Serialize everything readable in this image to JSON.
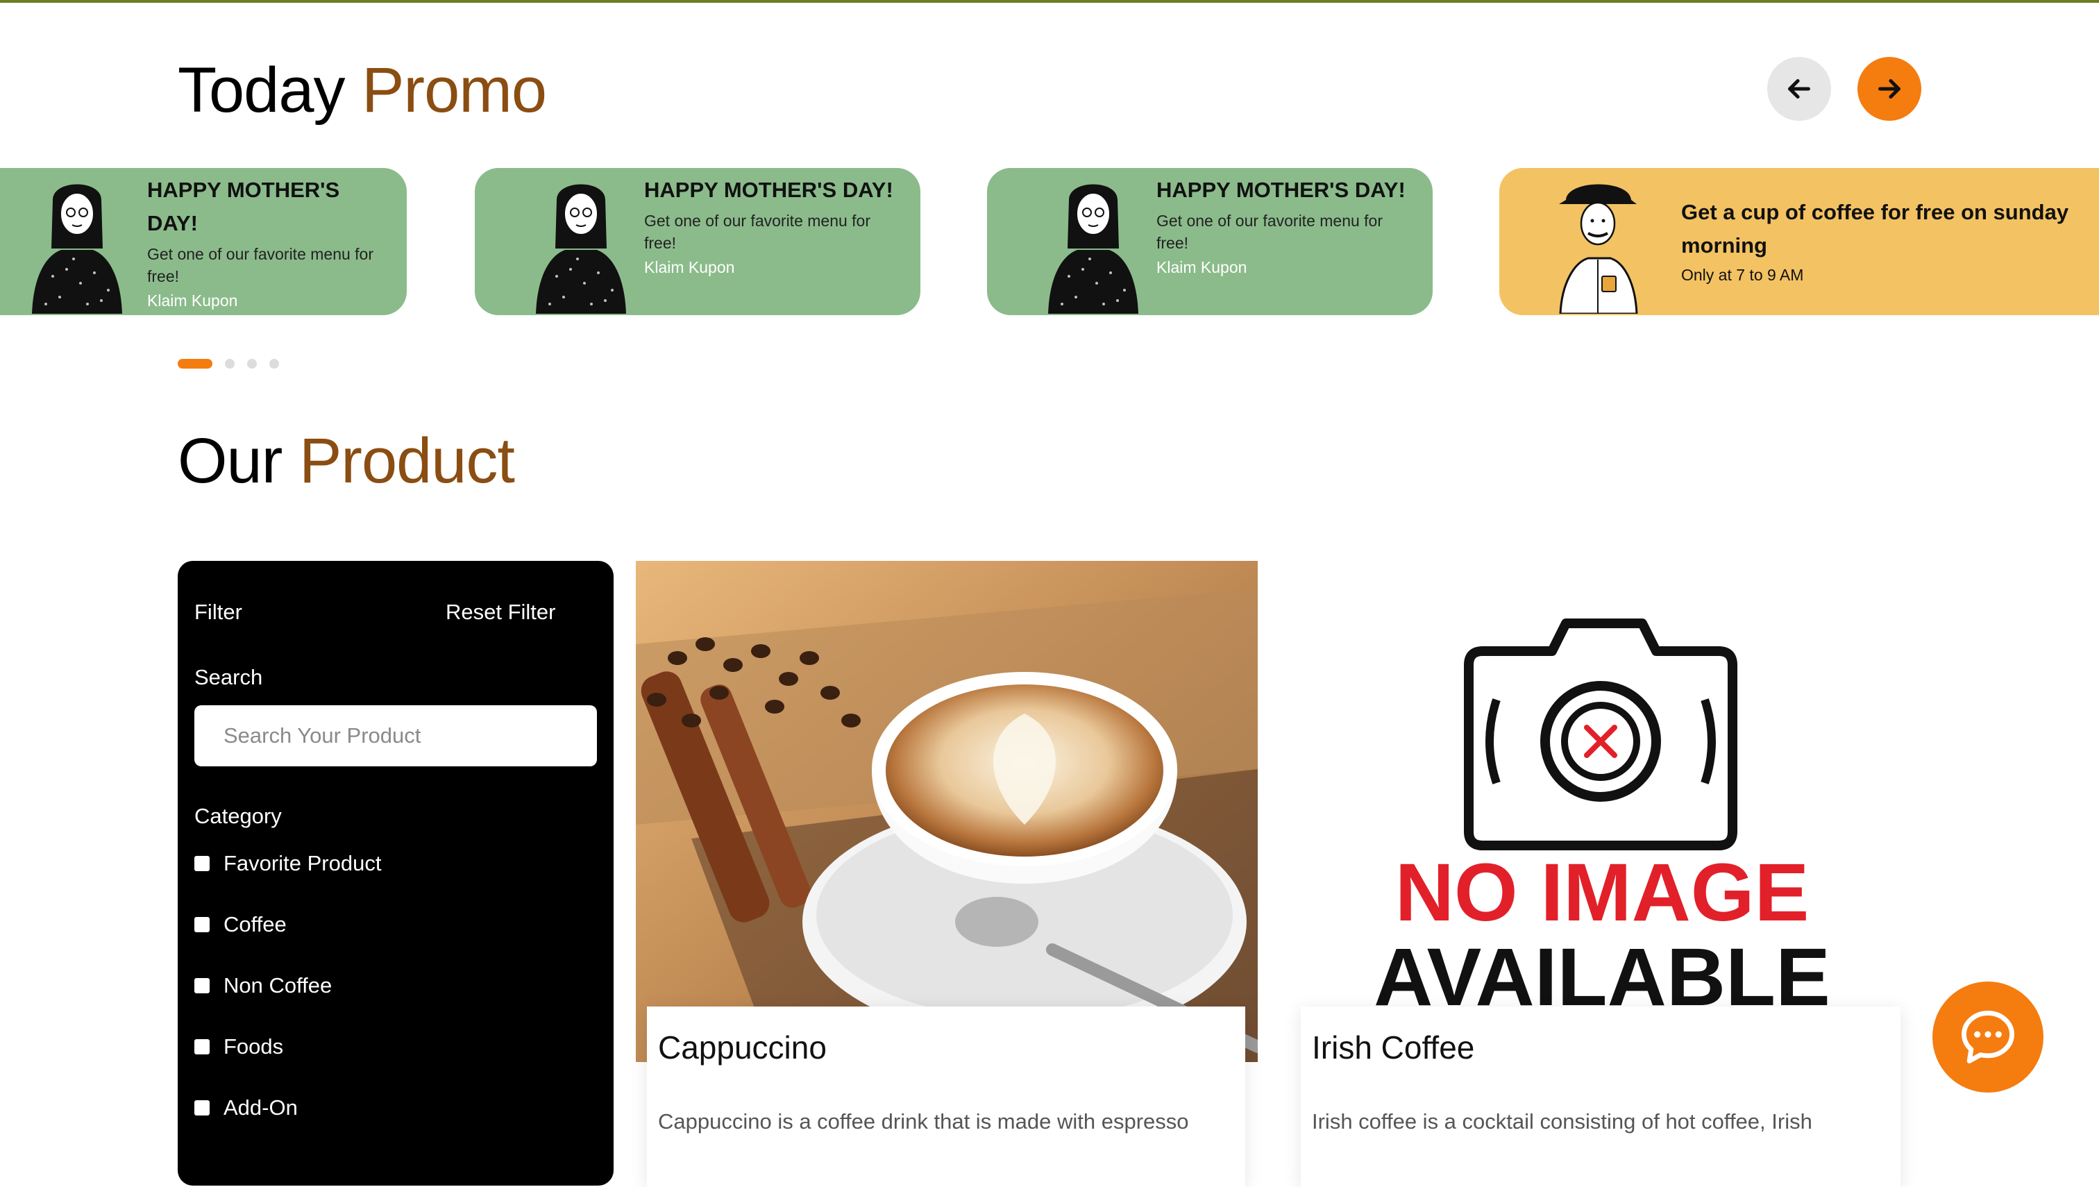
{
  "promo": {
    "title_plain": "Today",
    "title_accent": "Promo",
    "prev_icon": "arrow-left-icon",
    "next_icon": "arrow-right-icon",
    "cards": [
      {
        "title": "HAPPY MOTHER'S DAY!",
        "desc": "Get one of our favorite menu for free!",
        "link": "Klaim Kupon",
        "color": "#8bbb8b"
      },
      {
        "title": "HAPPY MOTHER'S DAY!",
        "desc": "Get one of our favorite menu for free!",
        "link": "Klaim Kupon",
        "color": "#8bbb8b"
      },
      {
        "title": "HAPPY MOTHER'S DAY!",
        "desc": "Get one of our favorite menu for free!",
        "link": "Klaim Kupon",
        "color": "#8bbb8b"
      },
      {
        "title": "Get a cup of coffee for free on sunday morning",
        "desc": "Only at 7 to 9 AM",
        "color": "#f3c262"
      }
    ],
    "active_slide": 1,
    "slide_count": 4
  },
  "product": {
    "title_plain": "Our",
    "title_accent": "Product",
    "accent_color": "#8a4d12"
  },
  "filter": {
    "title": "Filter",
    "reset": "Reset Filter",
    "search_label": "Search",
    "search_placeholder": "Search Your Product",
    "search_value": "",
    "category_label": "Category",
    "categories": [
      "Favorite Product",
      "Coffee",
      "Non Coffee",
      "Foods",
      "Add-On"
    ]
  },
  "products": [
    {
      "name": "Cappuccino",
      "desc": "Cappuccino is a coffee drink that is made with espresso"
    },
    {
      "name": "Irish Coffee",
      "desc": "Irish coffee is a cocktail consisting of hot coffee, Irish",
      "no_image_line1": "NO IMAGE",
      "no_image_line2": "AVAILABLE"
    }
  ],
  "colors": {
    "brand_orange": "#f57c0f",
    "promo_green": "#8bbb8b",
    "promo_yellow": "#f3c262"
  },
  "chat": {
    "icon": "chat-bubble-icon"
  }
}
